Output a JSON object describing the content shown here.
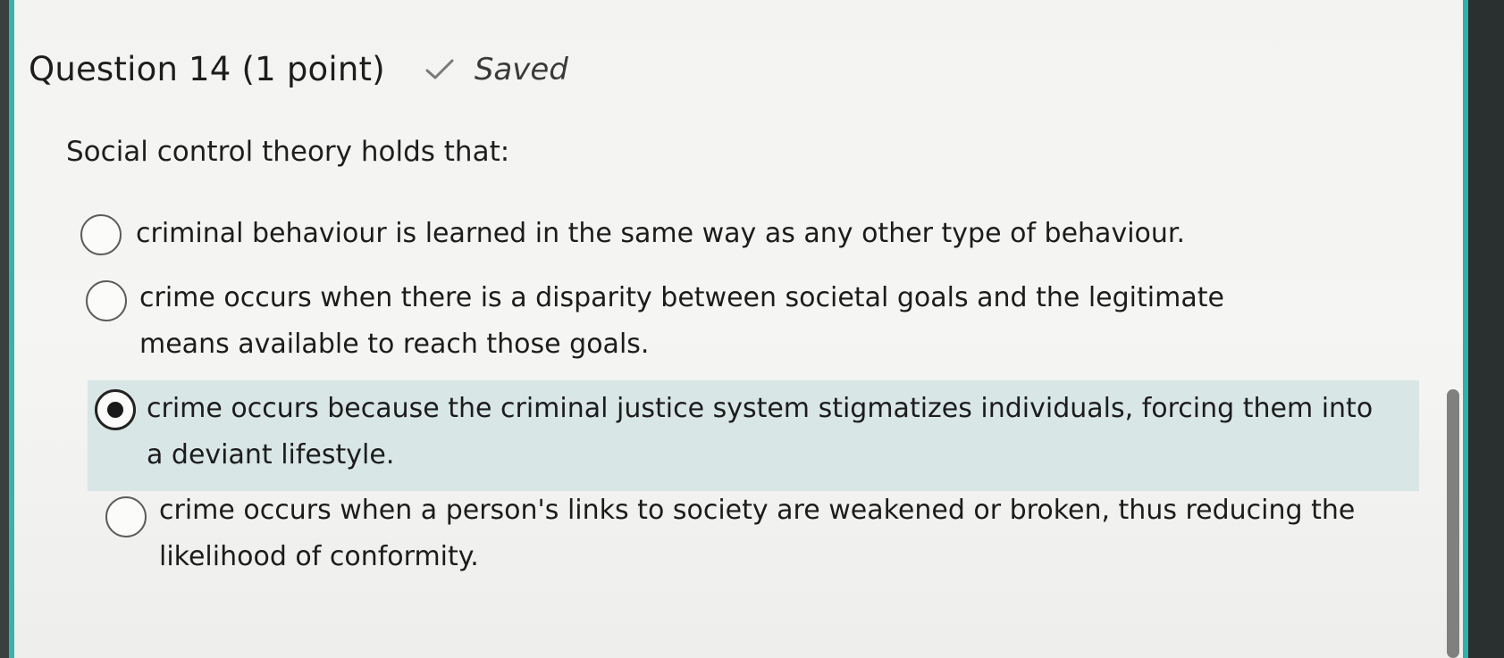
{
  "question": {
    "title": "Question 14 (1 point)",
    "status": "Saved",
    "status_icon": "checkmark-icon",
    "prompt": "Social control theory holds that:"
  },
  "options": [
    {
      "label": "criminal behaviour is learned in the same way as any other type of behaviour.",
      "selected": false
    },
    {
      "label": "crime occurs when there is a disparity between societal goals and the legitimate means available to reach those goals.",
      "selected": false
    },
    {
      "label": "crime occurs because the criminal justice system stigmatizes individuals, forcing them into a deviant lifestyle.",
      "selected": true
    },
    {
      "label": "crime occurs when a person's links to society are weakened or broken, thus reducing the likelihood of conformity.",
      "selected": false
    }
  ],
  "colors": {
    "accent": "#36b3ad",
    "selected_background": "#d9e6e6",
    "text": "#1c1c1c"
  }
}
